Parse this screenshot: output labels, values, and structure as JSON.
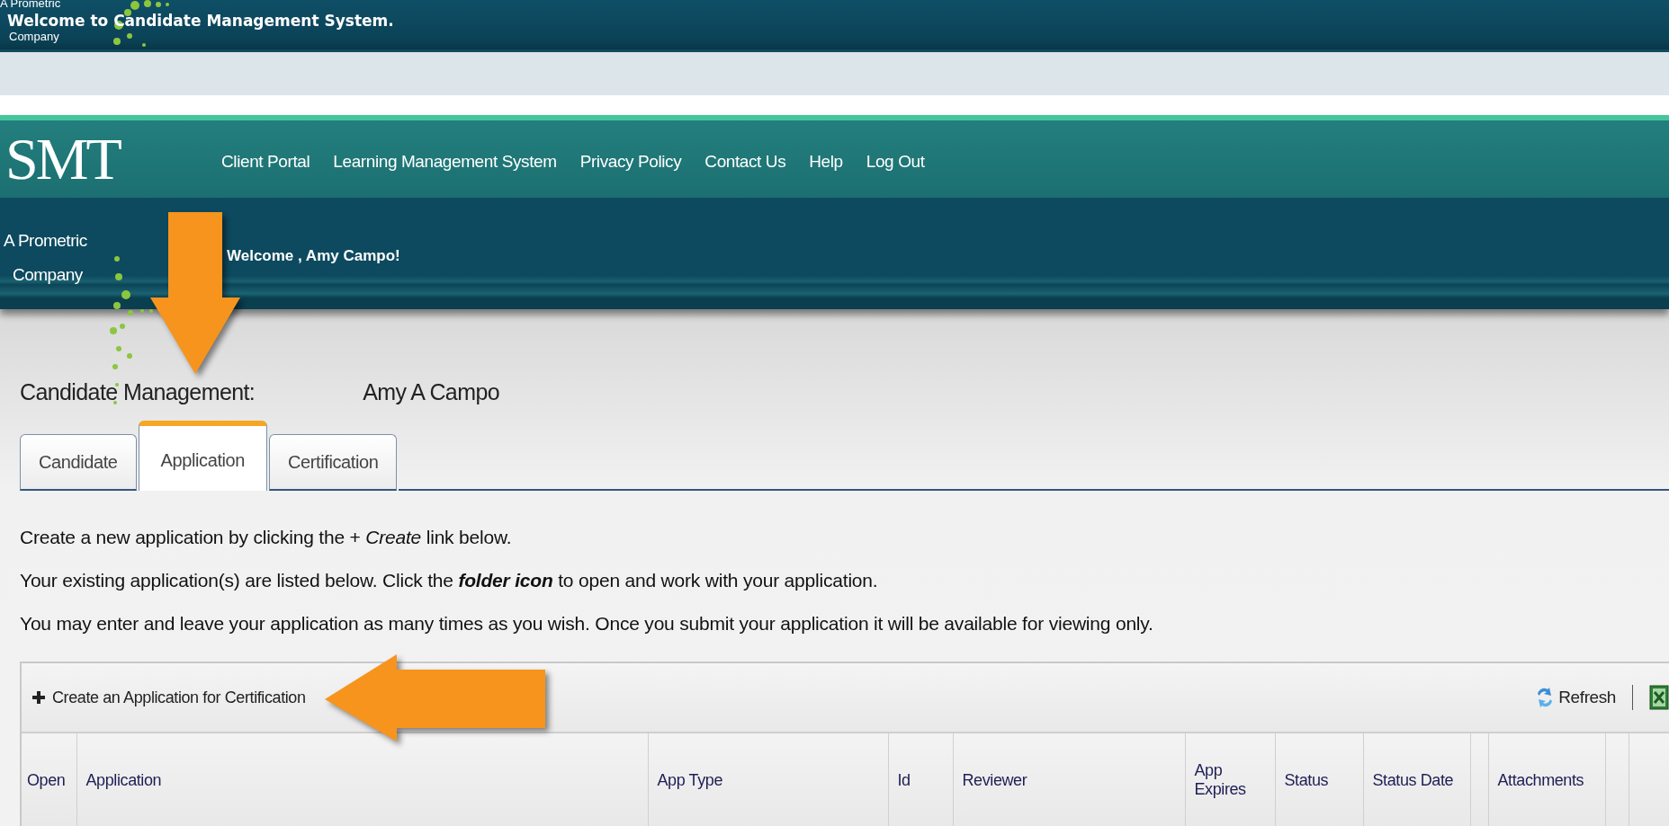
{
  "banner": {
    "logo_lines": [
      "A Prometric",
      "Company"
    ],
    "title": "Welcome to Candidate Management System."
  },
  "header": {
    "logo": "SMT",
    "tagline_lines": [
      "A Prometric",
      "Company"
    ],
    "nav": [
      "Client Portal",
      "Learning Management System",
      "Privacy Policy",
      "Contact Us",
      "Help",
      "Log Out"
    ],
    "welcome": "Welcome , Amy Campo!"
  },
  "candidate": {
    "label": "Candidate Management:",
    "name": "Amy A Campo"
  },
  "tabs": [
    {
      "label": "Candidate",
      "selected": false,
      "arrow_marked": false
    },
    {
      "label": "Application",
      "selected": true,
      "arrow_marked": true
    },
    {
      "label": "Certification",
      "selected": false,
      "arrow_marked": false
    }
  ],
  "instructions": [
    "Create a new application by clicking the + *Create* link below.",
    "Your existing application(s) are listed below. Click the **folder icon** to open and work with your application.",
    "You may enter and leave your application as many times as you wish. Once you submit your application it will be available for viewing only."
  ],
  "toolbar": {
    "create": "Create an Application for Certification",
    "create_arrow_marked": true,
    "refresh": "Refresh"
  },
  "table": {
    "columns": [
      {
        "kind": "text",
        "label": "Open"
      },
      {
        "kind": "text",
        "label": "Application"
      },
      {
        "kind": "text",
        "label": "App Type"
      },
      {
        "kind": "text",
        "label": "Id"
      },
      {
        "kind": "text",
        "label": "Reviewer"
      },
      {
        "kind": "text",
        "label": "App Expires"
      },
      {
        "kind": "text",
        "label": "Status"
      },
      {
        "kind": "text",
        "label": "Status Date"
      },
      {
        "kind": "spacer"
      },
      {
        "kind": "text",
        "label": "Attachments"
      },
      {
        "kind": "spacer"
      },
      {
        "kind": "spacer"
      }
    ]
  }
}
